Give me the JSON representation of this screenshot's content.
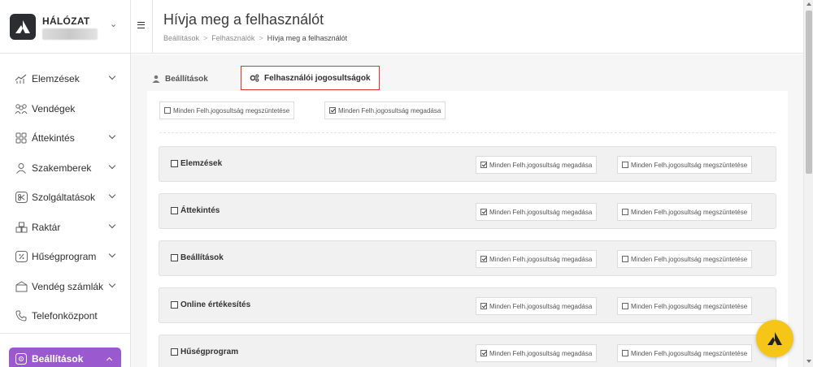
{
  "brand": {
    "name": "HÁLÓZAT"
  },
  "sidebar": {
    "items": [
      {
        "label": "Elemzések",
        "icon": "analytics-icon",
        "has_chevron": true
      },
      {
        "label": "Vendégek",
        "icon": "guests-icon",
        "has_chevron": false
      },
      {
        "label": "Áttekintés",
        "icon": "overview-icon",
        "has_chevron": true
      },
      {
        "label": "Szakemberek",
        "icon": "person-icon",
        "has_chevron": true
      },
      {
        "label": "Szolgáltatások",
        "icon": "scissors-icon",
        "has_chevron": true
      },
      {
        "label": "Raktár",
        "icon": "warehouse-icon",
        "has_chevron": true
      },
      {
        "label": "Hűségprogram",
        "icon": "loyalty-icon",
        "has_chevron": true
      },
      {
        "label": "Vendég számlák",
        "icon": "invoice-icon",
        "has_chevron": true
      },
      {
        "label": "Telefonközpont",
        "icon": "phone-icon",
        "has_chevron": false
      }
    ],
    "active": {
      "label": "Beállítások",
      "icon": "settings-gear-icon"
    }
  },
  "header": {
    "title": "Hívja meg a felhasználót",
    "breadcrumb": [
      "Beállítások",
      "Felhasználók",
      "Hívja meg a felhasználót"
    ]
  },
  "tabs": [
    {
      "label": "Beállítások",
      "icon": "user-icon",
      "selected": false
    },
    {
      "label": "Felhasználói jogosultságok",
      "icon": "gears-icon",
      "selected": true
    }
  ],
  "panel": {
    "revoke_all_label": "Minden Felh.jogosultság megszüntetése",
    "grant_all_label": "Minden Felh.jogosultság megadása",
    "sections": [
      {
        "title": "Elemzések",
        "grant_label": "Minden Felh.jogosultság megadása",
        "revoke_label": "Minden Felh.jogosultság megszüntetése"
      },
      {
        "title": "Áttekintés",
        "grant_label": "Minden Felh.jogosultság megadása",
        "revoke_label": "Minden Felh.jogosultság megszüntetése"
      },
      {
        "title": "Beállítások",
        "grant_label": "Minden Felh.jogosultság megadása",
        "revoke_label": "Minden Felh.jogosultság megszüntetése"
      },
      {
        "title": "Online értékesítés",
        "grant_label": "Minden Felh.jogosultság megadása",
        "revoke_label": "Minden Felh.jogosultság megszüntetése"
      },
      {
        "title": "Hűségprogram",
        "grant_label": "Minden Felh.jogosultság megadása",
        "revoke_label": "Minden Felh.jogosultság megszüntetése"
      }
    ]
  },
  "colors": {
    "accent_purple": "#9b59d0",
    "highlight_red": "#d9342b",
    "fab_yellow": "#f5c518",
    "brand_dark": "#2b2d31"
  }
}
